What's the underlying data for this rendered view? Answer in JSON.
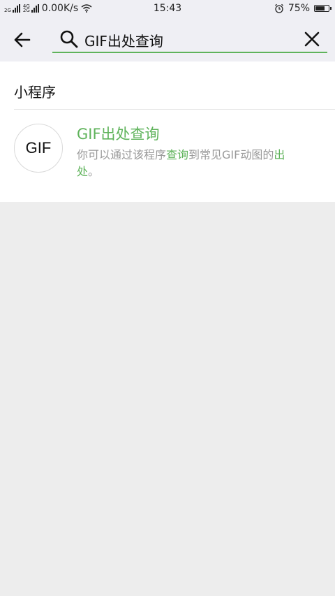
{
  "status_bar": {
    "network1": "2G",
    "network2a": "4G",
    "network2b": "2G",
    "speed": "0.00K/s",
    "time": "15:43",
    "battery_text": "75%",
    "battery_level": 0.75,
    "icons": [
      "signal-icon",
      "wifi-icon",
      "alarm-icon",
      "battery-icon"
    ]
  },
  "search": {
    "query": "GIF出处查询",
    "accent": "#5fb35b"
  },
  "results": {
    "section_title": "小程序",
    "items": [
      {
        "avatar_text": "GIF",
        "title": "GIF出处查询",
        "desc_parts": [
          {
            "text": "你可以通过该程序",
            "highlight": false
          },
          {
            "text": "查询",
            "highlight": true
          },
          {
            "text": "到常见GIF动图的",
            "highlight": false
          },
          {
            "text": "出处",
            "highlight": true
          },
          {
            "text": "。",
            "highlight": false
          }
        ]
      }
    ]
  },
  "colors": {
    "highlight": "#5fb35b",
    "background": "#ededed",
    "header": "#efeff4"
  }
}
